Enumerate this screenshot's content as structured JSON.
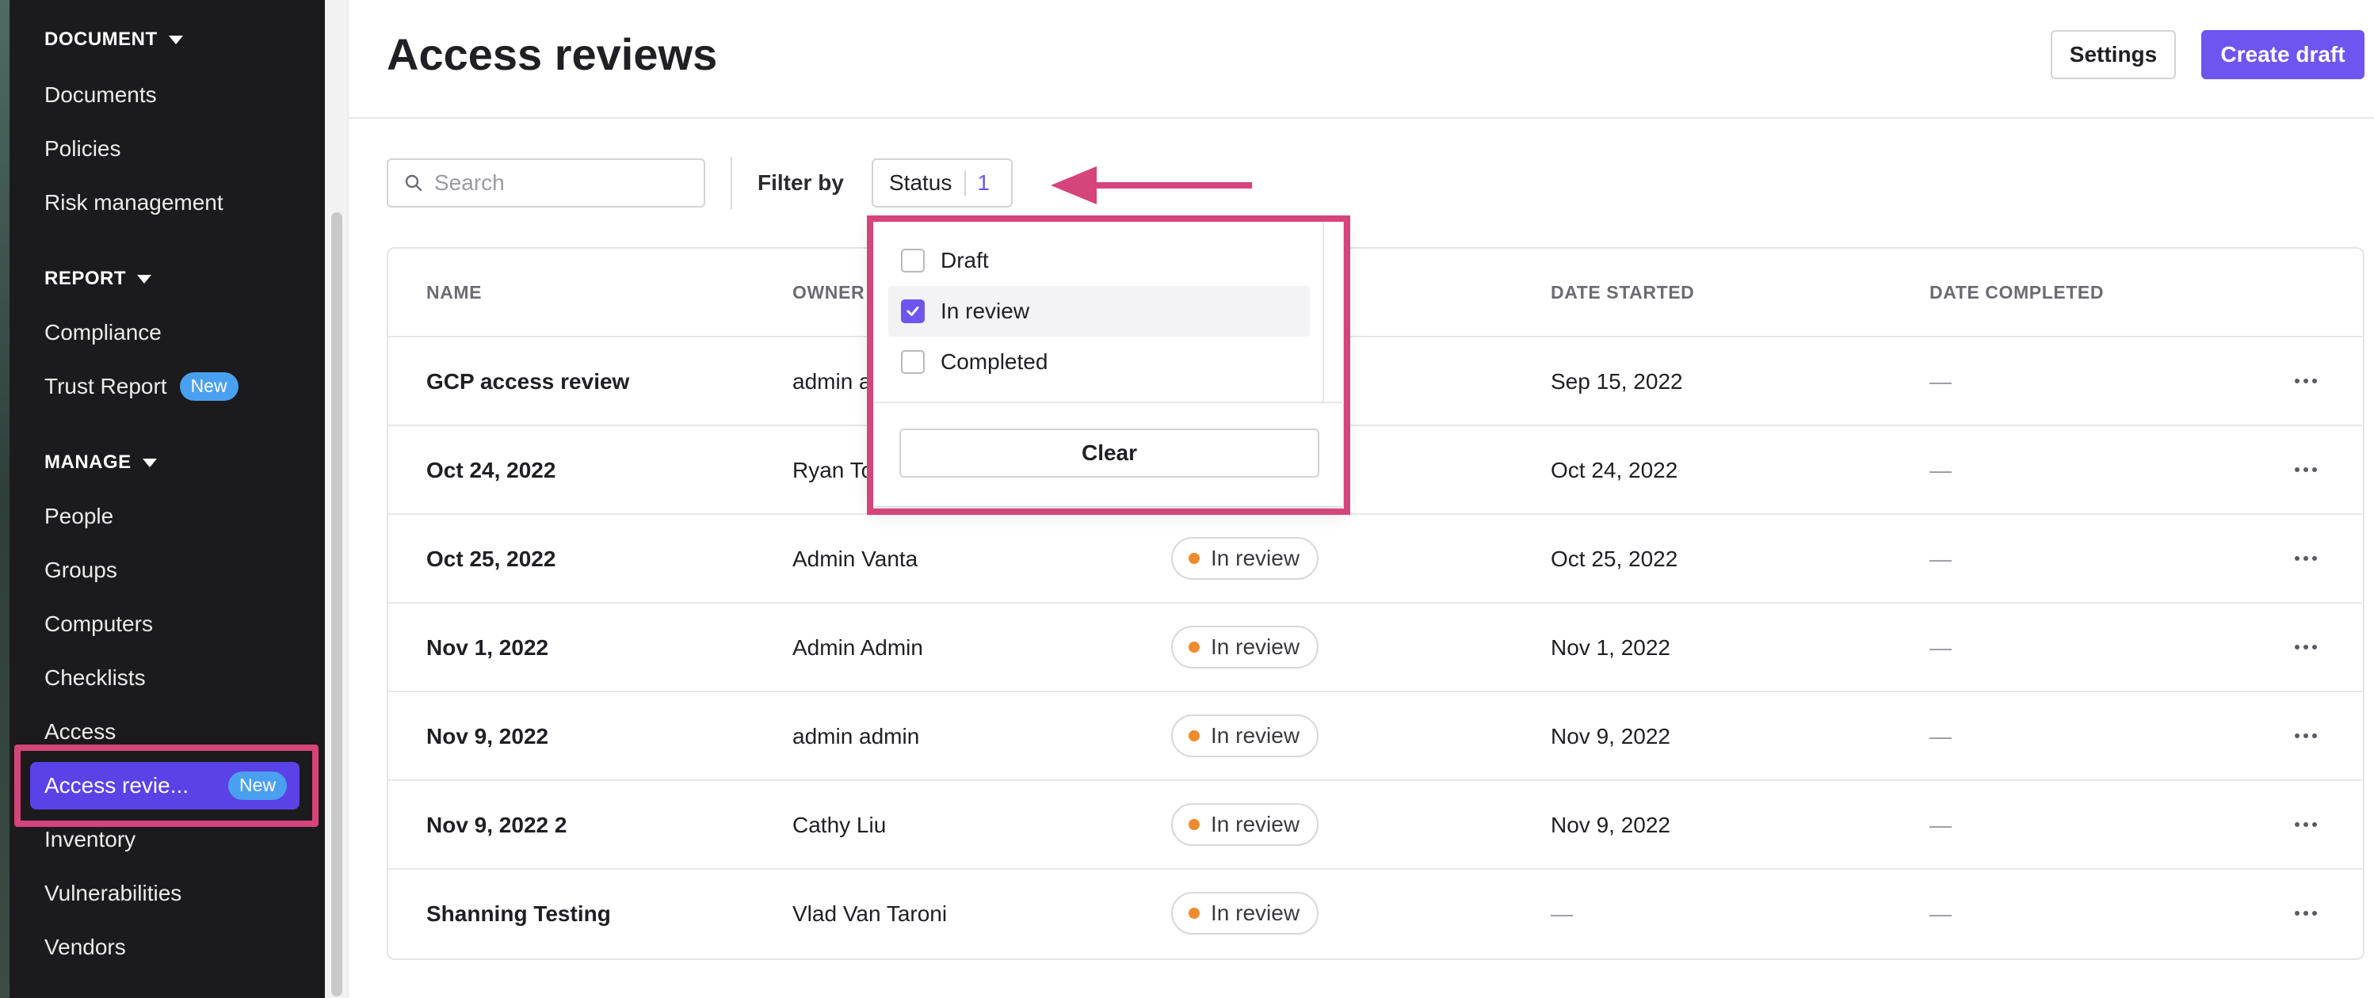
{
  "sidebar": {
    "sections": [
      {
        "title": "DOCUMENT",
        "items": [
          "Documents",
          "Policies",
          "Risk management"
        ]
      },
      {
        "title": "REPORT",
        "items": [
          "Compliance",
          "Trust Report"
        ]
      },
      {
        "title": "MANAGE",
        "items": [
          "People",
          "Groups",
          "Computers",
          "Checklists",
          "Access",
          "Access revie...",
          "Inventory",
          "Vulnerabilities",
          "Vendors"
        ]
      }
    ],
    "new_badge": "New",
    "active_item": "Access revie..."
  },
  "header": {
    "title": "Access reviews",
    "settings_label": "Settings",
    "create_label": "Create draft"
  },
  "filters": {
    "search_placeholder": "Search",
    "filter_by_label": "Filter by",
    "status_label": "Status",
    "status_count": "1"
  },
  "dropdown": {
    "options": [
      {
        "label": "Draft",
        "checked": false
      },
      {
        "label": "In review",
        "checked": true
      },
      {
        "label": "Completed",
        "checked": false
      }
    ],
    "clear_label": "Clear"
  },
  "table": {
    "columns": [
      "NAME",
      "OWNER",
      "DATE STARTED",
      "DATE COMPLETED"
    ],
    "owner_visible": [
      "admin a",
      "Ryan To"
    ],
    "rows": [
      {
        "name": "GCP access review",
        "owner": "admin admin",
        "status": "",
        "started": "Sep 15, 2022",
        "completed": "—"
      },
      {
        "name": "Oct 24, 2022",
        "owner": "Ryan To",
        "status": "",
        "started": "Oct 24, 2022",
        "completed": "—"
      },
      {
        "name": "Oct 25, 2022",
        "owner": "Admin Vanta",
        "status": "In review",
        "started": "Oct 25, 2022",
        "completed": "—"
      },
      {
        "name": "Nov 1, 2022",
        "owner": "Admin Admin",
        "status": "In review",
        "started": "Nov 1, 2022",
        "completed": "—"
      },
      {
        "name": "Nov 9, 2022",
        "owner": "admin admin",
        "status": "In review",
        "started": "Nov 9, 2022",
        "completed": "—"
      },
      {
        "name": "Nov 9, 2022 2",
        "owner": "Cathy Liu",
        "status": "In review",
        "started": "Nov 9, 2022",
        "completed": "—"
      },
      {
        "name": "Shanning Testing",
        "owner": "Vlad Van Taroni",
        "status": "In review",
        "started": "—",
        "completed": "—"
      }
    ]
  },
  "colors": {
    "accent": "#6e55ef",
    "highlight": "#d5447a",
    "status_dot": "#ef8a2d",
    "sidebar_bg": "#1b1b1d",
    "badge_new": "#4aa0f0"
  },
  "icons": {
    "search": "search-icon",
    "caret": "caret-down-icon",
    "check": "check-icon",
    "more": "more-horizontal-icon",
    "arrow": "arrow-left-icon"
  }
}
